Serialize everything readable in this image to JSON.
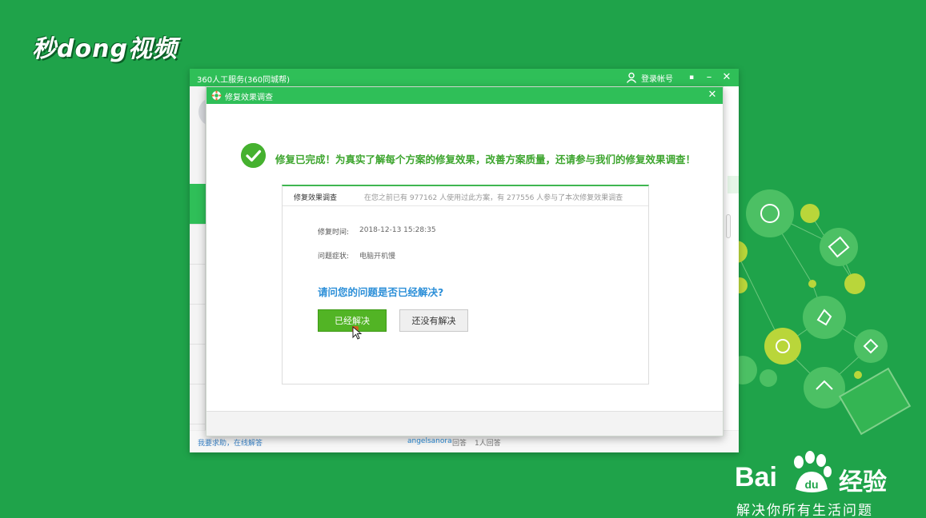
{
  "watermark": {
    "brand_topleft": "秒dong视频",
    "baidu_bai": "Bai",
    "baidu_du": "du",
    "baidu_jingyan": "经验",
    "slogan": "解决你所有生活问题"
  },
  "app_window": {
    "title": "360人工服务(360同城帮)",
    "login_label": "登录帐号",
    "minimize_glyph": "–",
    "close_glyph": "✕",
    "chat_glyph": "▪"
  },
  "background_content": {
    "side_link": "我要求助，在线解答",
    "answer_user": "angelsanora",
    "answer_action": "回答",
    "answer_count": "1人回答"
  },
  "dialog": {
    "title": "修复效果调查",
    "close_glyph": "✕",
    "headline": "修复已完成！为真实了解每个方案的修复效果，改善方案质量，还请参与我们的修复效果调查！",
    "panel": {
      "tab_label": "修复效果调查",
      "stats": "在您之前已有 977162 人使用过此方案，有 277556 人参与了本次修复效果调查",
      "repair_time_label": "修复时间:",
      "repair_time_value": "2018-12-13 15:28:35",
      "symptom_label": "问题症状:",
      "symptom_value": "电脑开机慢",
      "question": "请问您的问题是否已经解决?",
      "btn_yes": "已经解决",
      "btn_no": "还没有解决"
    }
  },
  "colors": {
    "background": "#1fa34a",
    "titlebar": "#2fbf58",
    "success_green": "#3da52e",
    "question_blue": "#2c8fd8",
    "button_green": "#52b425"
  }
}
